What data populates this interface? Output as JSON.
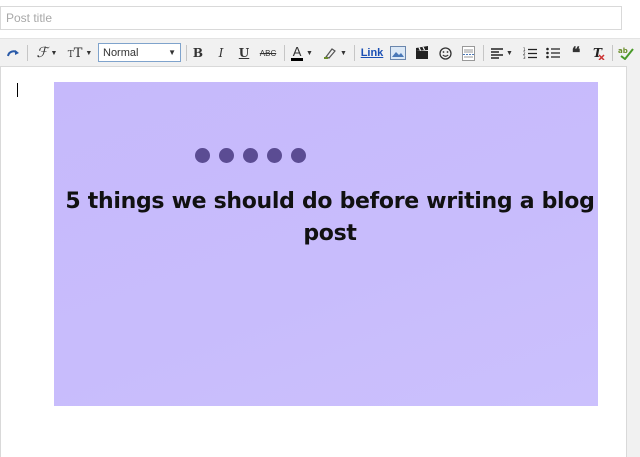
{
  "post_title": {
    "placeholder": "Post title",
    "value": ""
  },
  "toolbar": {
    "redo_icon": "redo-icon",
    "font_icon": "font-family-icon",
    "font_size_icon": "font-size-icon",
    "format_select": "Normal",
    "bold_label": "B",
    "italic_label": "I",
    "underline_label": "U",
    "strikethrough_label": "ABC",
    "text_color_label": "A",
    "link_label": "Link",
    "colors": {
      "link": "#1a4fb4",
      "text_color_bar": "#000000",
      "highlight": "#6a8d2a"
    }
  },
  "editor": {
    "banner": {
      "heading": "5 things we should do before writing a blog post",
      "dot_count": 5,
      "background": "#c6b9fb",
      "dot_color": "#5b4c93"
    }
  }
}
